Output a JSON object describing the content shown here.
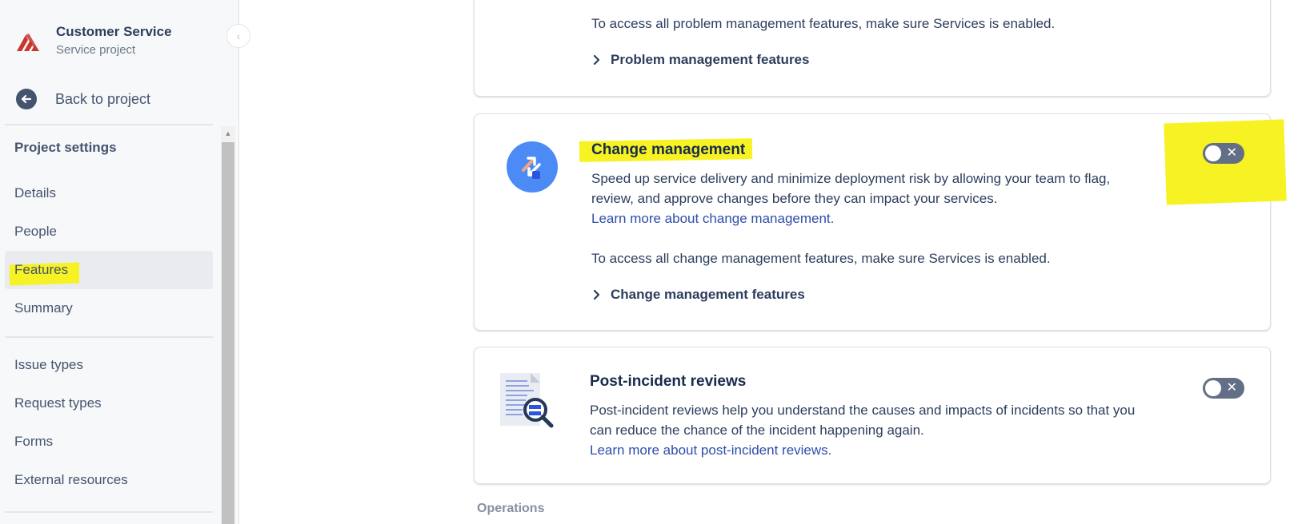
{
  "project": {
    "name": "Customer Service",
    "type": "Service project"
  },
  "sidebar": {
    "back_label": "Back to project",
    "section_title": "Project settings",
    "items": [
      {
        "label": "Details"
      },
      {
        "label": "People"
      },
      {
        "label": "Features",
        "active": true
      },
      {
        "label": "Summary"
      },
      {
        "label": "Issue types"
      },
      {
        "label": "Request types"
      },
      {
        "label": "Forms"
      },
      {
        "label": "External resources"
      }
    ]
  },
  "cards": {
    "problem": {
      "access_text": "To access all problem management features, make sure Services is enabled.",
      "expander_label": "Problem management features"
    },
    "change": {
      "title": "Change management",
      "description_line1": "Speed up service delivery and minimize deployment risk by allowing your team to flag,",
      "description_line2": "review, and approve changes before they can impact your services.",
      "learn_more": "Learn more about change management.",
      "access_text": "To access all change management features, make sure Services is enabled.",
      "expander_label": "Change management features",
      "toggle_enabled": false
    },
    "pir": {
      "title": "Post-incident reviews",
      "description_line1": "Post-incident reviews help you understand the causes and impacts of incidents so that you",
      "description_line2": "can reduce the chance of the incident happening again.",
      "learn_more": "Learn more about post-incident reviews.",
      "toggle_enabled": false
    }
  },
  "next_section": "Operations",
  "colors": {
    "highlight": "#f7f223",
    "link": "#2e4ea9",
    "toggle_off": "#626f86",
    "logo": "#c9372c",
    "change_icon_bg": "#4c8bf5"
  },
  "icons": {
    "logo": "atlassian-service-logo-icon",
    "back": "arrow-left-icon",
    "change": "change-arrows-icon",
    "pir": "document-magnifier-icon",
    "expander": "chevron-right-icon"
  }
}
